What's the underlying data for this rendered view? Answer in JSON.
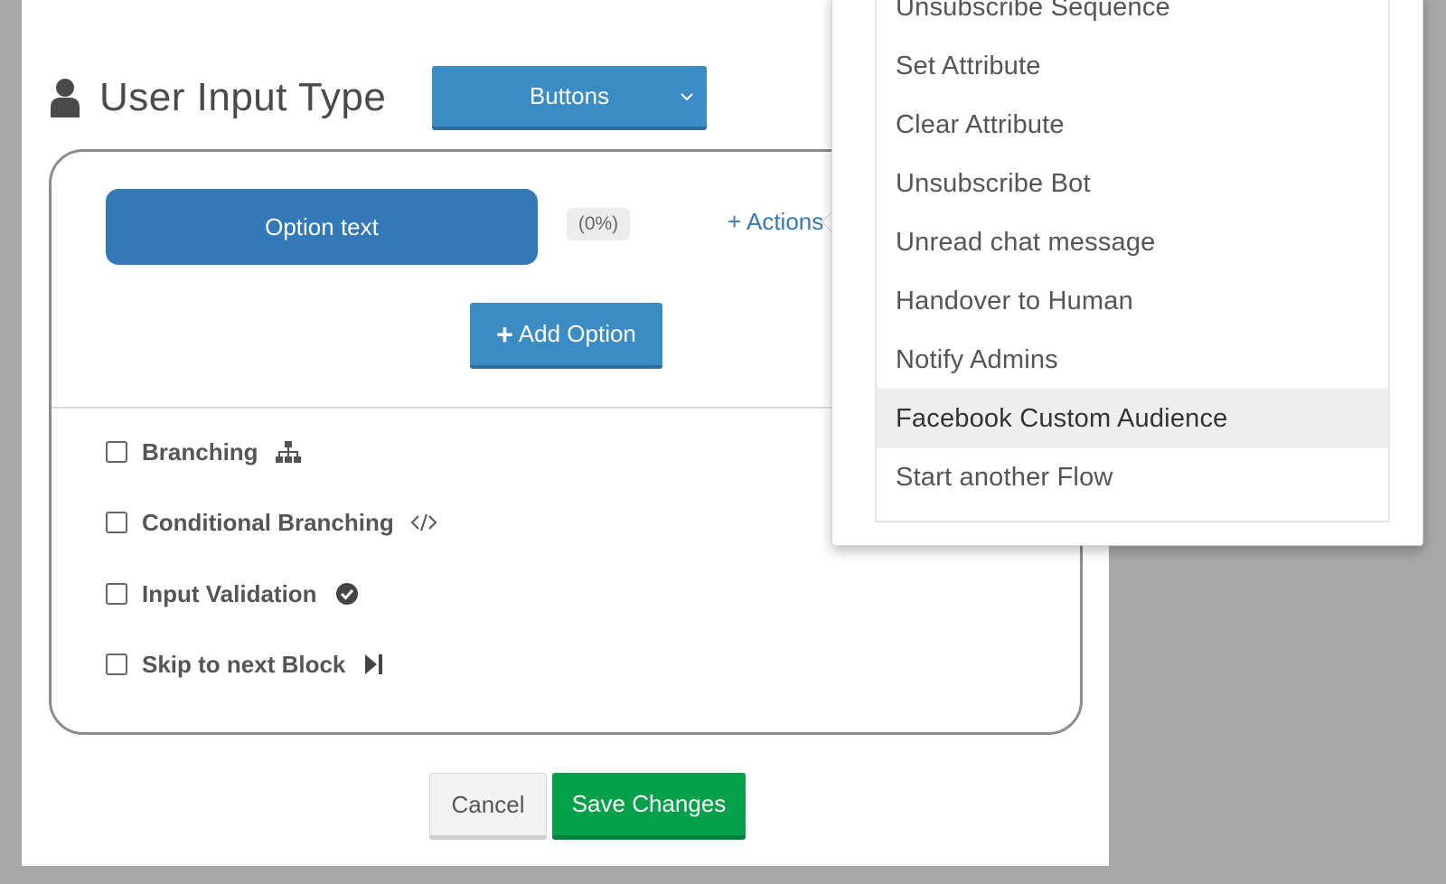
{
  "header": {
    "title": "User Input Type",
    "type_select": "Buttons"
  },
  "option": {
    "text": "Option text",
    "percent": "(0%)",
    "actions_link": "+ Actions",
    "add_option": "Add Option"
  },
  "settings": [
    {
      "label": "Branching",
      "icon": "sitemap-icon"
    },
    {
      "label": "Conditional Branching",
      "icon": "code-icon"
    },
    {
      "label": "Input Validation",
      "icon": "check-circle-icon"
    },
    {
      "label": "Skip to next Block",
      "icon": "step-forward-icon"
    }
  ],
  "footer": {
    "cancel": "Cancel",
    "save": "Save Changes"
  },
  "actions_menu": {
    "items": [
      "Unsubscribe Sequence",
      "Set Attribute",
      "Clear Attribute",
      "Unsubscribe Bot",
      "Unread chat message",
      "Handover to Human",
      "Notify Admins",
      "Facebook Custom Audience",
      "Start another Flow"
    ],
    "highlighted": "Facebook Custom Audience"
  },
  "colors": {
    "primary": "#3b8bc4",
    "option_button": "#3479b7",
    "save": "#05a04a",
    "backdrop": "#a8a8a8"
  }
}
